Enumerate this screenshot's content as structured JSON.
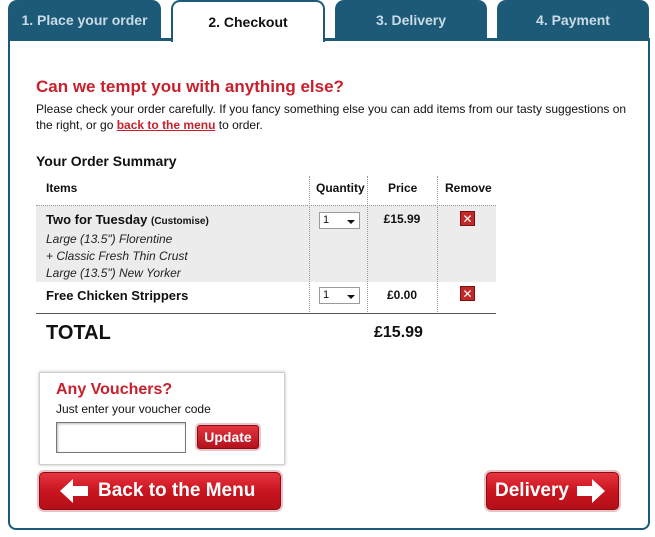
{
  "tabs": [
    {
      "label": "1. Place your order"
    },
    {
      "label": "2. Checkout"
    },
    {
      "label": "3. Delivery"
    },
    {
      "label": "4. Payment"
    }
  ],
  "headline": "Can we tempt you with anything else?",
  "intro": {
    "before_link": "Please check your order carefully. If you fancy something else you can add items from our tasty suggestions on the right, or go ",
    "link": "back to the menu",
    "after_link": " to order."
  },
  "summary": {
    "title": "Your Order Summary",
    "columns": {
      "items": "Items",
      "quantity": "Quantity",
      "price": "Price",
      "remove": "Remove"
    },
    "rows": [
      {
        "name": "Two for Tuesday",
        "customise": "(Customise)",
        "details": [
          "Large (13.5\") Florentine",
          "+ Classic Fresh Thin Crust",
          "Large (13.5\") New Yorker"
        ],
        "quantity": "1",
        "price": "£15.99"
      },
      {
        "name": "Free Chicken Strippers",
        "quantity": "1",
        "price": "£0.00"
      }
    ],
    "total_label": "TOTAL",
    "total_value": "£15.99"
  },
  "voucher": {
    "title": "Any Vouchers?",
    "subtitle": "Just enter your voucher code",
    "input_value": "",
    "update_label": "Update"
  },
  "buttons": {
    "back": "Back to the Menu",
    "delivery": "Delivery"
  },
  "colors": {
    "brand_red": "#c8202c",
    "tab_blue": "#1d5a78"
  }
}
